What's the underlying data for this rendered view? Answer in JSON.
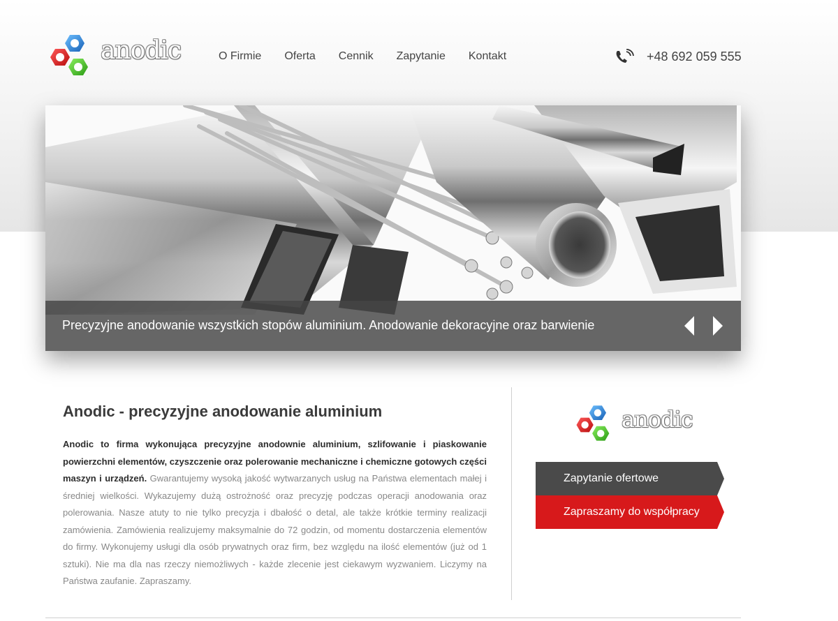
{
  "brand": {
    "name": "anodic",
    "colors": {
      "red": "#e02020",
      "blue": "#2d8fe0",
      "green": "#43c92a",
      "accent_red": "#d7191b",
      "dark": "#4a4a4a"
    }
  },
  "nav": {
    "items": [
      {
        "label": "O Firmie"
      },
      {
        "label": "Oferta"
      },
      {
        "label": "Cennik"
      },
      {
        "label": "Zapytanie"
      },
      {
        "label": "Kontakt"
      }
    ]
  },
  "contact": {
    "phone": "+48 692 059 555",
    "icon": "phone-icon"
  },
  "slider": {
    "caption": "Precyzyjne anodowanie wszystkich stopów aluminium. Anodowanie dekoracyjne oraz barwienie",
    "prev_icon": "arrow-left-icon",
    "next_icon": "arrow-right-icon"
  },
  "main": {
    "title": "Anodic - precyzyjne anodowanie aluminium",
    "lead_bold": "Anodic to firma wykonująca precyzyjne anodownie aluminium, szlifowanie i piaskowanie powierzchni elementów, czyszczenie oraz polerowanie mechaniczne i chemiczne gotowych części maszyn i urządzeń.",
    "body": " Gwarantujemy wysoką jakość wytwarzanych usług na Państwa elementach małej i średniej wielkości. Wykazujemy dużą ostrożność oraz precyzję podczas operacji anodowania oraz polerowania. Nasze atuty to nie tylko precyzja i dbałość o detal, ale także krótkie terminy realizacji zamówienia. Zamówienia realizujemy maksymalnie do 72 godzin, od momentu dostarczenia elementów do firmy. Wykonujemy usługi dla osób prywatnych oraz firm, bez względu na ilość elementów (już od 1 sztuki). Nie ma dla nas rzeczy niemożliwych - każde zlecenie jest ciekawym wyzwaniem. Liczymy na Państwa zaufanie. Zapraszamy."
  },
  "sidebar": {
    "cta_inquiry": "Zapytanie ofertowe",
    "cta_cooperation": "Zapraszamy do współpracy"
  }
}
